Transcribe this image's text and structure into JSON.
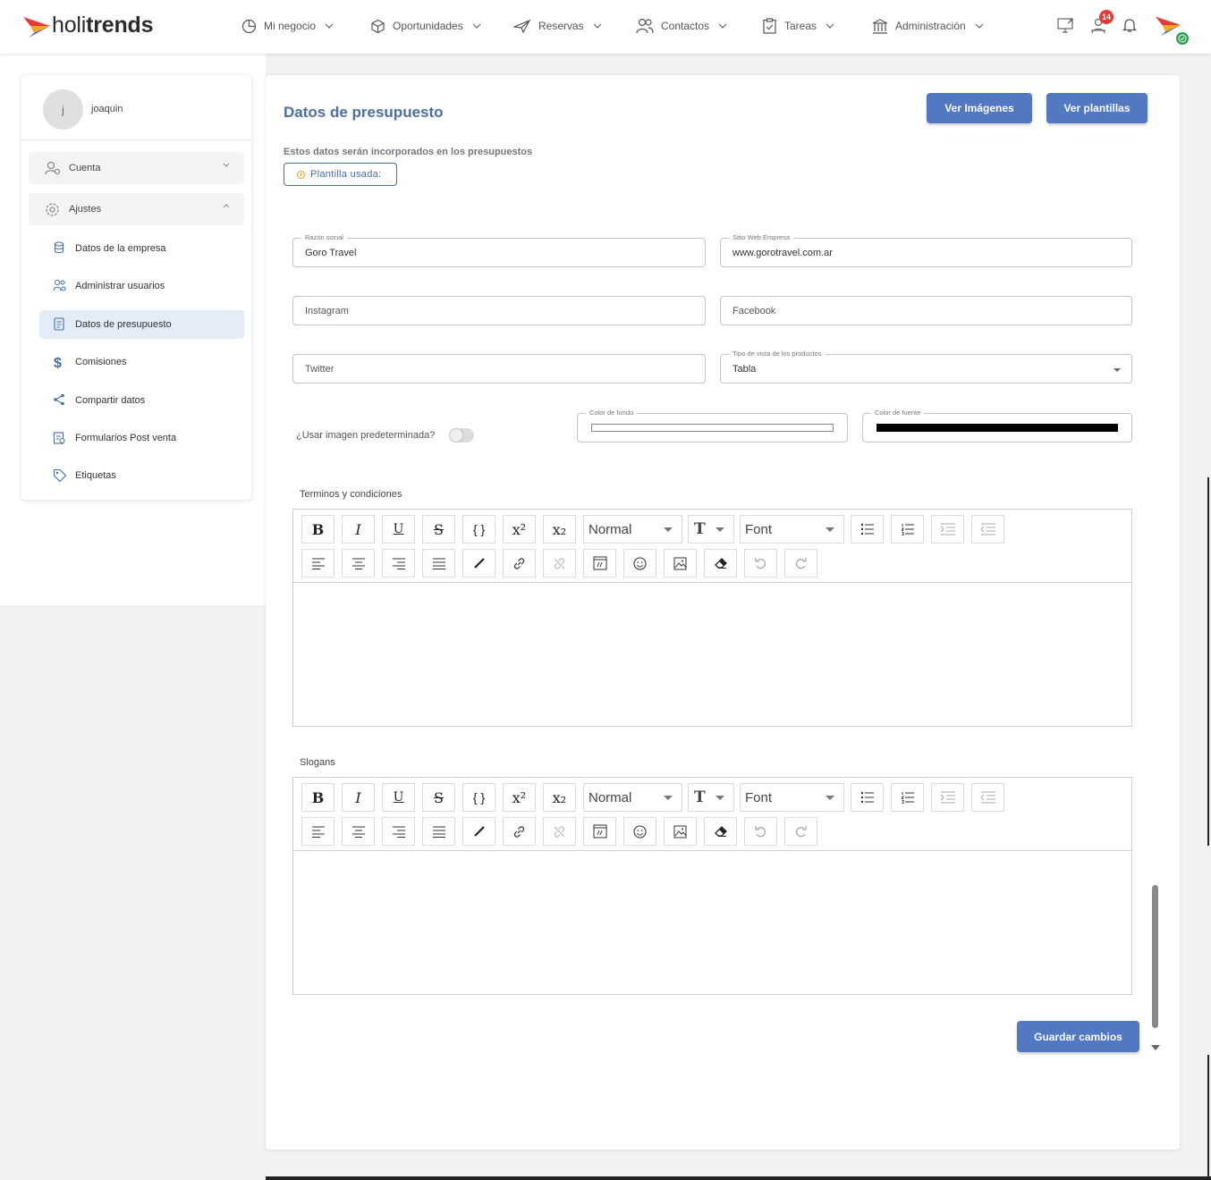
{
  "app": {
    "logo_light": "holi",
    "logo_bold": "trends",
    "notification_count": "14"
  },
  "nav": [
    {
      "label": "Mi negocio",
      "icon": "pie-chart-icon"
    },
    {
      "label": "Oportunidades",
      "icon": "cube-icon"
    },
    {
      "label": "Reservas",
      "icon": "plane-icon"
    },
    {
      "label": "Contactos",
      "icon": "users-icon"
    },
    {
      "label": "Tareas",
      "icon": "clipboard-icon"
    },
    {
      "label": "Administración",
      "icon": "bank-icon"
    }
  ],
  "sidebar": {
    "avatar_initial": "j",
    "username": "joaquin",
    "groups": [
      {
        "label": "Cuenta",
        "icon": "user-settings-icon",
        "expanded": false
      },
      {
        "label": "Ajustes",
        "icon": "gear-icon",
        "expanded": true
      }
    ],
    "items": [
      {
        "label": "Datos de la empresa",
        "icon": "database-icon"
      },
      {
        "label": "Administrar usuarios",
        "icon": "user-group-icon"
      },
      {
        "label": "Datos de presupuesto",
        "icon": "document-icon",
        "active": true
      },
      {
        "label": "Comisiones",
        "icon": "dollar-icon"
      },
      {
        "label": "Compartir datos",
        "icon": "share-icon"
      },
      {
        "label": "Formularios Post venta",
        "icon": "form-icon"
      },
      {
        "label": "Etiquetas",
        "icon": "tag-icon"
      }
    ]
  },
  "main": {
    "title": "Datos de presupuesto",
    "btn_images": "Ver Imágenes",
    "btn_templates": "Ver plantillas",
    "subtitle": "Estos datos serán incorporados en los presupuestos",
    "template_chip": "Plantilla usada:",
    "fields": {
      "razon_label": "Razón social",
      "razon_value": "Goro Travel",
      "web_label": "Sitio Web Empresa",
      "web_value": "www.gorotravel.com.ar",
      "instagram_placeholder": "Instagram",
      "facebook_placeholder": "Facebook",
      "twitter_placeholder": "Twitter",
      "vista_label": "Tipo de vista de los productos",
      "vista_value": "Tabla",
      "bg_label": "Color de fondo",
      "bg_color": "#ffffff",
      "font_label": "Color de fuente",
      "font_color": "#000000"
    },
    "toggle_label": "¿Usar imagen predeterminada?",
    "toggle_on": false,
    "terms_label": "Terminos y condiciones",
    "slogans_label": "Slogans",
    "editor": {
      "size_value": "Normal",
      "font_value": "Font"
    },
    "save_button": "Guardar cambios"
  },
  "colors": {
    "accent": "#5278c2",
    "title": "#4a6fa5",
    "active_bg": "#e4ecf8",
    "badge": "#e53935"
  }
}
